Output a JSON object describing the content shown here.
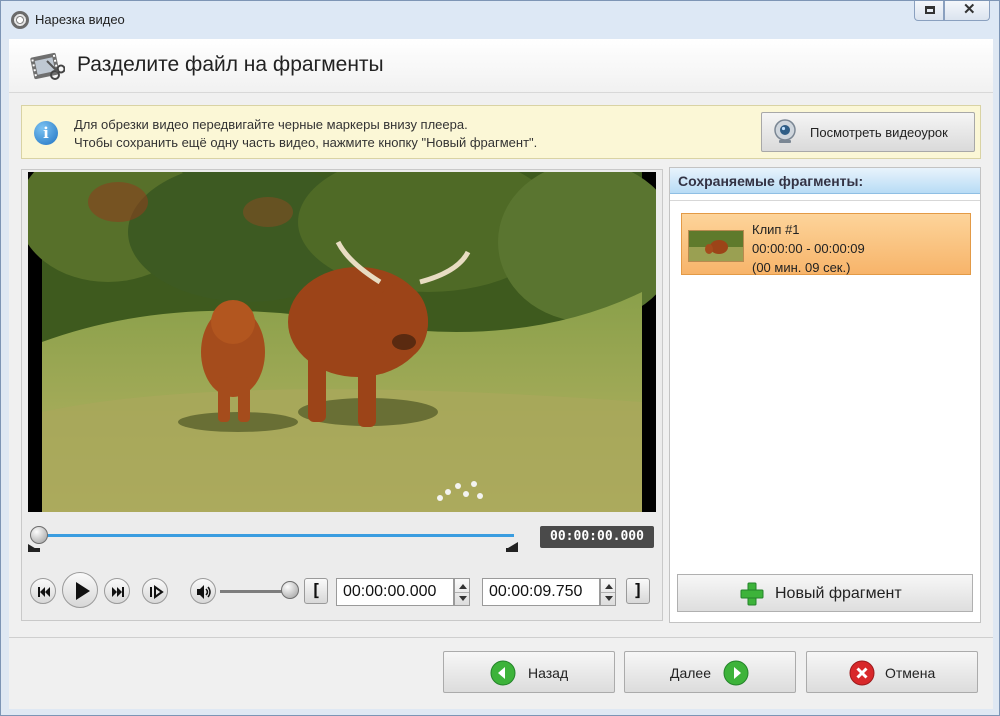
{
  "window": {
    "title": "Нарезка видео"
  },
  "header": {
    "title": "Разделите файл на фрагменты"
  },
  "info": {
    "line1": "Для обрезки видео передвигайте черные маркеры внизу плеера.",
    "line2": "Чтобы сохранить ещё одну часть видео, нажмите кнопку \"Новый фрагмент\".",
    "lesson_button": "Посмотреть видеоурок"
  },
  "player": {
    "current_time": "00:00:00.000",
    "start_time": "00:00:00.000",
    "end_time": "00:00:09.750",
    "playhead_fraction": 0.0,
    "volume_fraction": 1.0
  },
  "fragments": {
    "header": "Сохраняемые фрагменты:",
    "items": [
      {
        "name": "Клип #1",
        "range": "00:00:00 - 00:00:09",
        "duration": "(00 мин. 09 сек.)"
      }
    ],
    "new_button": "Новый фрагмент"
  },
  "footer": {
    "back": "Назад",
    "next": "Далее",
    "cancel": "Отмена"
  },
  "colors": {
    "accent": "#3a9de0",
    "clip_highlight": "#f7b46a",
    "plus_green": "#3db33a",
    "cancel_red": "#d8282a"
  }
}
